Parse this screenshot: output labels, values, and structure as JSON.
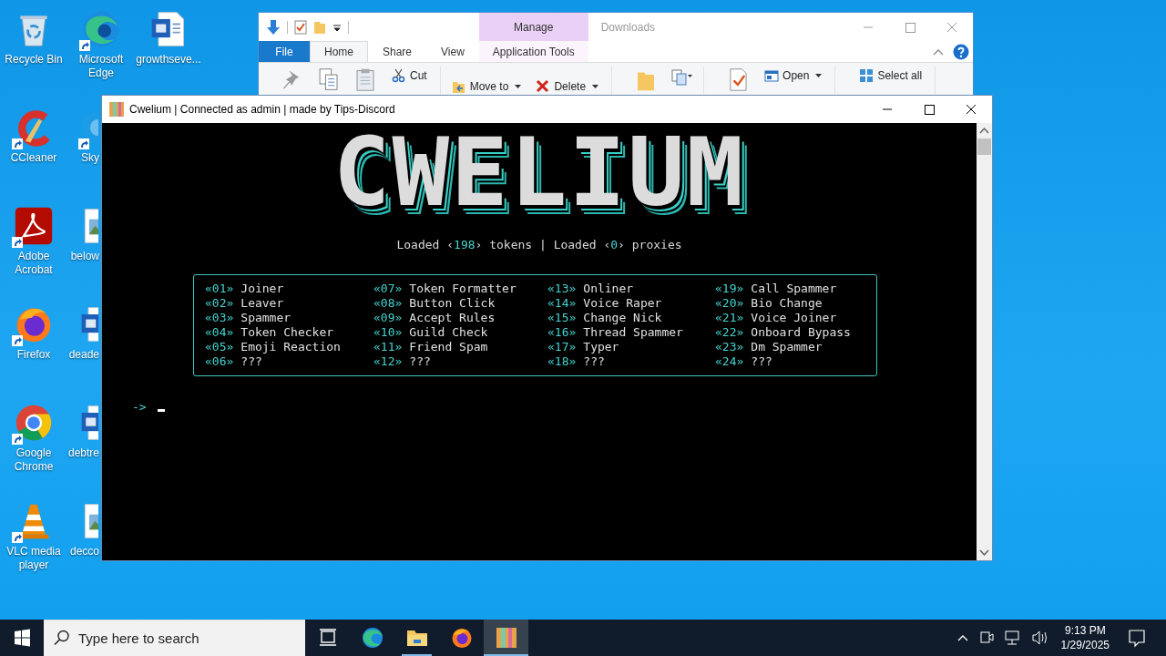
{
  "desktop": {
    "columns": [
      [
        {
          "label": "Recycle Bin",
          "kind": "recycle-bin",
          "shortcut": false
        },
        {
          "label": "CCleaner",
          "kind": "cleaner",
          "shortcut": true
        },
        {
          "label": "Adobe Acrobat",
          "kind": "pdf",
          "shortcut": true
        },
        {
          "label": "Firefox",
          "kind": "firefox",
          "shortcut": true
        },
        {
          "label": "Google Chrome",
          "kind": "chrome",
          "shortcut": true
        },
        {
          "label": "VLC media player",
          "kind": "cone",
          "shortcut": true
        }
      ],
      [
        {
          "label": "Microsoft Edge",
          "kind": "edge",
          "shortcut": true
        },
        {
          "label": "Sky",
          "kind": "skype",
          "shortcut": true
        },
        {
          "label": "below",
          "kind": "image-file",
          "shortcut": false
        },
        {
          "label": "deade",
          "kind": "word",
          "shortcut": false
        },
        {
          "label": "debtre",
          "kind": "word",
          "shortcut": false
        },
        {
          "label": "decco",
          "kind": "image-file",
          "shortcut": false
        }
      ],
      [
        {
          "label": "growthseve...",
          "kind": "word",
          "shortcut": false
        }
      ]
    ]
  },
  "explorer": {
    "title": "Downloads",
    "tabs": [
      {
        "label": "File",
        "kind": "file",
        "selected": false
      },
      {
        "label": "Home",
        "kind": "normal",
        "selected": true
      },
      {
        "label": "Share",
        "kind": "normal",
        "selected": false
      },
      {
        "label": "View",
        "kind": "normal",
        "selected": false
      },
      {
        "label": "Application Tools",
        "kind": "context",
        "group": "Manage",
        "selected": false
      }
    ],
    "ribbon_buttons": [
      {
        "label": "Cut",
        "dropdown": false
      },
      {
        "label": "Move to",
        "dropdown": true
      },
      {
        "label": "Delete",
        "dropdown": true
      },
      {
        "label": "Open",
        "dropdown": true
      },
      {
        "label": "Select all",
        "dropdown": false
      }
    ]
  },
  "console": {
    "title": "Cwelium | Connected as admin | made by Tips-Discord",
    "logo": "CWELIUM",
    "status_line": [
      {
        "text": "Loaded ‹",
        "kind": "plain"
      },
      {
        "text": "198",
        "kind": "count"
      },
      {
        "text": "› tokens | Loaded ‹",
        "kind": "plain"
      },
      {
        "text": "0",
        "kind": "count"
      },
      {
        "text": "› proxies",
        "kind": "plain"
      }
    ],
    "menu": [
      {
        "number": "«01»",
        "label": "Joiner"
      },
      {
        "number": "«02»",
        "label": "Leaver"
      },
      {
        "number": "«03»",
        "label": "Spammer"
      },
      {
        "number": "«04»",
        "label": "Token Checker"
      },
      {
        "number": "«05»",
        "label": "Emoji Reaction"
      },
      {
        "number": "«06»",
        "label": "???"
      },
      {
        "number": "«07»",
        "label": "Token Formatter"
      },
      {
        "number": "«08»",
        "label": "Button Click"
      },
      {
        "number": "«09»",
        "label": "Accept Rules"
      },
      {
        "number": "«10»",
        "label": "Guild Check"
      },
      {
        "number": "«11»",
        "label": "Friend Spam"
      },
      {
        "number": "«12»",
        "label": "???"
      },
      {
        "number": "«13»",
        "label": "Onliner"
      },
      {
        "number": "«14»",
        "label": "Voice Raper"
      },
      {
        "number": "«15»",
        "label": "Change Nick"
      },
      {
        "number": "«16»",
        "label": "Thread Spammer"
      },
      {
        "number": "«17»",
        "label": "Typer"
      },
      {
        "number": "«18»",
        "label": "???"
      },
      {
        "number": "«19»",
        "label": "Call Spammer"
      },
      {
        "number": "«20»",
        "label": "Bio Change"
      },
      {
        "number": "«21»",
        "label": "Voice Joiner"
      },
      {
        "number": "«22»",
        "label": "Onboard Bypass"
      },
      {
        "number": "«23»",
        "label": "Dm Spammer"
      },
      {
        "number": "«24»",
        "label": "???"
      }
    ],
    "prompt": "->"
  },
  "taskbar": {
    "search": {
      "placeholder": "Type here to search"
    },
    "apps": [
      {
        "kind": "task-view",
        "running": false,
        "active": false
      },
      {
        "kind": "edge",
        "running": false,
        "active": false
      },
      {
        "kind": "folder",
        "running": true,
        "active": false
      },
      {
        "kind": "firefox",
        "running": false,
        "active": false
      },
      {
        "kind": "app",
        "running": true,
        "active": true
      }
    ],
    "clock": {
      "time": "9:13 PM",
      "date": "1/29/2025"
    }
  }
}
